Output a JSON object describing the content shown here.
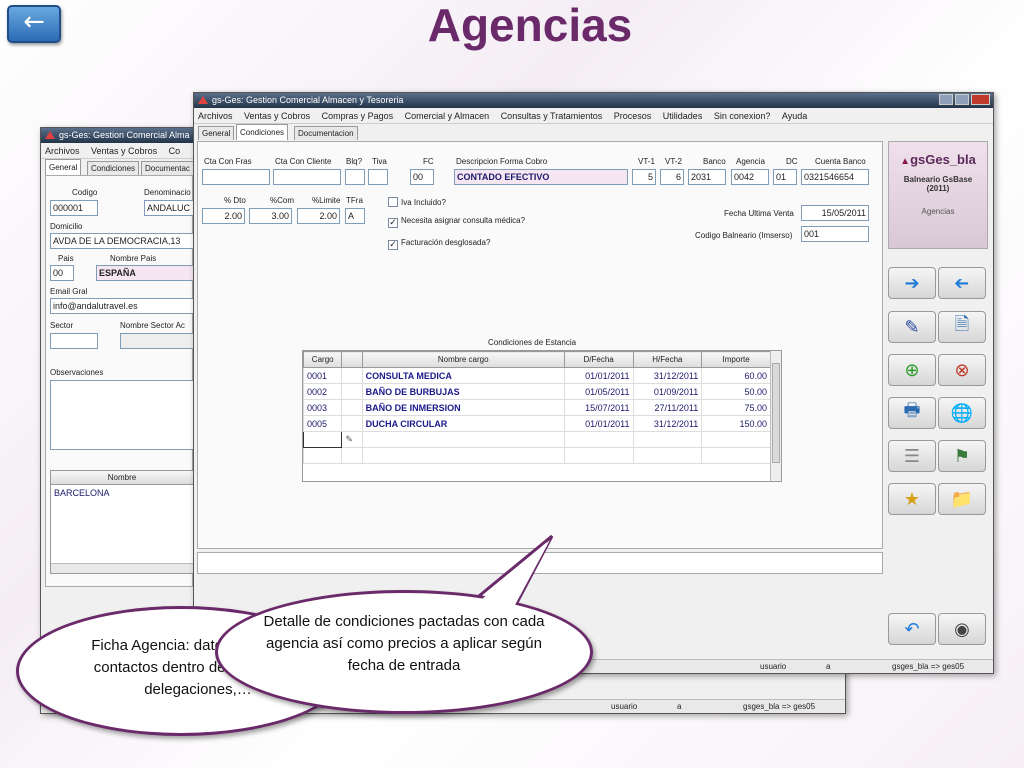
{
  "slide": {
    "title": "Agencias",
    "back_label": "←"
  },
  "back_window": {
    "title": "gs-Ges: Gestion Comercial Alma",
    "menu": [
      "Archivos",
      "Ventas y Cobros",
      "Co"
    ],
    "tabs": [
      "General",
      "Condiciones",
      "Documentac"
    ],
    "labels": {
      "codigo": "Codigo",
      "denominacion": "Denominacio",
      "domicilio": "Domicilio",
      "pais": "Pais",
      "nombre_pais": "Nombre Pais",
      "email": "Email Gral",
      "sector": "Sector",
      "nombre_sector": "Nombre Sector Ac",
      "observaciones": "Observaciones",
      "nombre_col": "Nombre"
    },
    "values": {
      "codigo": "000001",
      "denominacion": "ANDALUC",
      "domicilio": "AVDA DE LA DEMOCRACIA,13",
      "pais": "00",
      "nombre_pais": "ESPAÑA",
      "email": "info@andalutravel.es",
      "list_item": "BARCELONA"
    },
    "status": {
      "user_label": "usuario",
      "user_value": "a",
      "db": "gsges_bla => ges05"
    }
  },
  "front_window": {
    "title": "gs-Ges: Gestion Comercial Almacen y Tesoreria",
    "menu": [
      "Archivos",
      "Ventas y Cobros",
      "Compras y Pagos",
      "Comercial y Almacen",
      "Consultas y Tratamientos",
      "Procesos",
      "Utilidades",
      "Sin conexion?",
      "Ayuda"
    ],
    "tabs": [
      "General",
      "Condiciones",
      "Documentacion"
    ],
    "fields": {
      "cta_con_fras": {
        "label": "Cta Con Fras",
        "value": ""
      },
      "cta_con_cliente": {
        "label": "Cta Con Cliente",
        "value": ""
      },
      "blq": {
        "label": "Blq?",
        "value": ""
      },
      "tiva": {
        "label": "Tiva",
        "value": ""
      },
      "fc": {
        "label": "FC",
        "value": "00"
      },
      "descripcion": {
        "label": "Descripcion Forma Cobro",
        "value": "CONTADO EFECTIVO"
      },
      "vt1": {
        "label": "VT-1",
        "value": "5"
      },
      "vt2": {
        "label": "VT-2",
        "value": "6"
      },
      "banco": {
        "label": "Banco",
        "value": "2031"
      },
      "agencia": {
        "label": "Agencia",
        "value": "0042"
      },
      "dc": {
        "label": "DC",
        "value": "01"
      },
      "cuenta": {
        "label": "Cuenta Banco",
        "value": "0321546654"
      },
      "dto": {
        "label": "% Dto",
        "value": "2.00"
      },
      "com": {
        "label": "%Com",
        "value": "3.00"
      },
      "limite": {
        "label": "%Limite",
        "value": "2.00"
      },
      "tfra": {
        "label": "TFra",
        "value": "A"
      },
      "fecha_ultima_venta": {
        "label": "Fecha Ultima Venta",
        "value": "15/05/2011"
      },
      "codigo_balneario": {
        "label": "Codigo Balneario (Imserso)",
        "value": "001"
      }
    },
    "checks": [
      {
        "label": "Iva Incluido?",
        "checked": false
      },
      {
        "label": "Necesita asignar consulta médica?",
        "checked": true
      },
      {
        "label": "Facturación desglosada?",
        "checked": true
      }
    ],
    "check_mark": "✓",
    "table": {
      "title": "Condiciones de Estancia",
      "headers": [
        "Cargo",
        "Nombre cargo",
        "D/Fecha",
        "H/Fecha",
        "Importe"
      ],
      "rows": [
        [
          "0001",
          "CONSULTA MEDICA",
          "01/01/2011",
          "31/12/2011",
          "60.00"
        ],
        [
          "0002",
          "BAÑO DE BURBUJAS",
          "01/05/2011",
          "01/09/2011",
          "50.00"
        ],
        [
          "0003",
          "BAÑO DE INMERSION",
          "15/07/2011",
          "27/11/2011",
          "75.00"
        ],
        [
          "0005",
          "DUCHA CIRCULAR",
          "01/01/2011",
          "31/12/2011",
          "150.00"
        ]
      ]
    },
    "brand": {
      "name": "gsGes_bla",
      "line1": "Balneario GsBase",
      "line2": "(2011)",
      "section": "Agencias"
    },
    "status": {
      "user_label": "usuario",
      "user_value": "a",
      "db": "gsges_bla => ges05"
    }
  },
  "bubbles": {
    "left": "Ficha Agencia: datos generales, contactos dentro de la agencia, delegaciones,…",
    "right": "Detalle de condiciones pactadas con cada agencia así como precios a aplicar según fecha de entrada"
  },
  "colors": {
    "accent": "#6a2a6a",
    "title_bar": "#23344a"
  }
}
